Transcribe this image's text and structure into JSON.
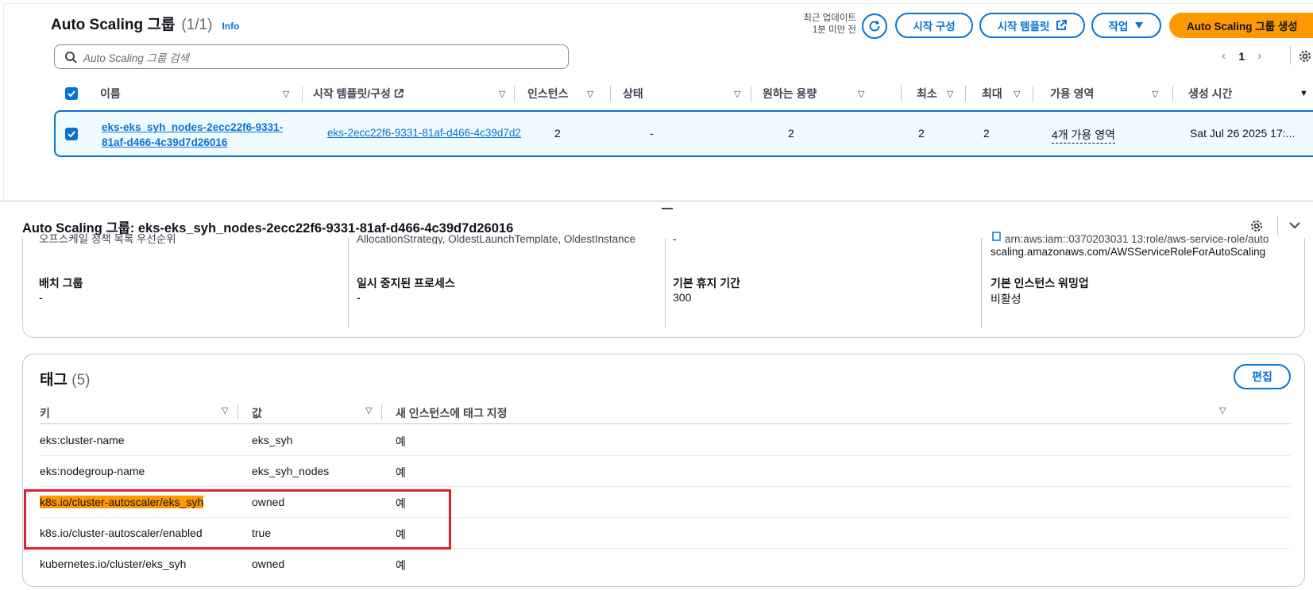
{
  "header": {
    "title": "Auto Scaling 그룹",
    "count": "(1/1)",
    "info": "Info",
    "last_update_label": "최근 업데이트",
    "last_update_value": "1분 미만 전",
    "buttons": {
      "launch_config": "시작 구성",
      "launch_template": "시작 템플릿",
      "actions": "작업",
      "create": "Auto Scaling 그룹 생성"
    }
  },
  "search": {
    "placeholder": "Auto Scaling 그룹 검색"
  },
  "pagination": {
    "current": "1"
  },
  "table": {
    "columns": [
      "이름",
      "시작 템플릿/구성",
      "인스턴스",
      "상태",
      "원하는 용량",
      "최소",
      "최대",
      "가용 영역",
      "생성 시간"
    ],
    "row": {
      "name_line1": "eks-eks_syh_nodes-2ecc22f6-9331-",
      "name_line2": "81af-d466-4c39d7d26016",
      "launch_template": "eks-2ecc22f6-9331-81af-d466-4c39d7d2",
      "instances": "2",
      "status": "-",
      "desired": "2",
      "min": "2",
      "max": "2",
      "azs": "4개 가용 영역",
      "created": "Sat Jul 26 2025 17:..."
    }
  },
  "detail": {
    "title": "Auto Scaling 그룹: eks-eks_syh_nodes-2ecc22f6-9331-81af-d466-4c39d7d26016",
    "clipped_col1": "오프스케일 정책 목록 우선순위",
    "clipped_col2": "AllocationStrategy, OldestLaunchTemplate, OldestInstance",
    "clipped_col3": "-",
    "clipped_col4_line1": "arn:aws:iam::0370203031 13:role/aws-service-role/auto",
    "clipped_col4_line2": "scaling.amazonaws.com/AWSServiceRoleForAutoScaling",
    "fields": [
      {
        "label": "배치 그룹",
        "value": "-"
      },
      {
        "label": "일시 중지된 프로세스",
        "value": "-"
      },
      {
        "label": "기본 휴지 기간",
        "value": "300"
      },
      {
        "label": "기본 인스턴스 워밍업",
        "value": "비활성"
      }
    ]
  },
  "tags": {
    "title": "태그",
    "count": "(5)",
    "edit": "편집",
    "columns": [
      "키",
      "값",
      "새 인스턴스에 태그 지정"
    ],
    "rows": [
      {
        "key": "eks:cluster-name",
        "value": "eks_syh",
        "propagate": "예"
      },
      {
        "key": "eks:nodegroup-name",
        "value": "eks_syh_nodes",
        "propagate": "예"
      },
      {
        "key": "k8s.io/cluster-autoscaler/eks_syh",
        "value": "owned",
        "propagate": "예"
      },
      {
        "key": "k8s.io/cluster-autoscaler/enabled",
        "value": "true",
        "propagate": "예"
      },
      {
        "key": "kubernetes.io/cluster/eks_syh",
        "value": "owned",
        "propagate": "예"
      }
    ]
  },
  "colors": {
    "accent": "#0972d3",
    "primary": "#ff9900",
    "highlight_box": "#e0202e"
  }
}
